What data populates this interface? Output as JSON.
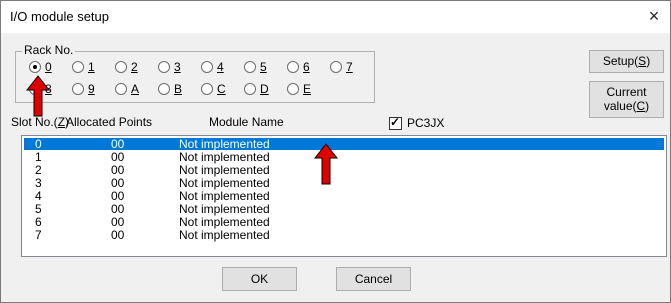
{
  "window": {
    "title": "I/O module setup",
    "close_glyph": "×"
  },
  "rack": {
    "legend": "Rack No.",
    "options": [
      "0",
      "1",
      "2",
      "3",
      "4",
      "5",
      "6",
      "7",
      "8",
      "9",
      "A",
      "B",
      "C",
      "D",
      "E"
    ],
    "selected": "0"
  },
  "buttons": {
    "setup_main": "Setup(",
    "setup_key": "S",
    "setup_end": ")",
    "current_line1": "Current",
    "current_line2_main": "value(",
    "current_key": "C",
    "current_end": ")",
    "ok": "OK",
    "cancel": "Cancel"
  },
  "pc3jx": {
    "label": "PC3JX",
    "checked": true
  },
  "table": {
    "col_slot_main": "Slot No.(",
    "col_slot_key": "Z",
    "col_slot_end": ")",
    "col_points": "Allocated Points",
    "col_module": "Module Name",
    "rows": [
      {
        "slot": "0",
        "points": "00",
        "module": "Not implemented"
      },
      {
        "slot": "1",
        "points": "00",
        "module": "Not implemented"
      },
      {
        "slot": "2",
        "points": "00",
        "module": "Not implemented"
      },
      {
        "slot": "3",
        "points": "00",
        "module": "Not implemented"
      },
      {
        "slot": "4",
        "points": "00",
        "module": "Not implemented"
      },
      {
        "slot": "5",
        "points": "00",
        "module": "Not implemented"
      },
      {
        "slot": "6",
        "points": "00",
        "module": "Not implemented"
      },
      {
        "slot": "7",
        "points": "00",
        "module": "Not implemented"
      }
    ],
    "selected_index": 0
  },
  "colors": {
    "selection": "#0078d7",
    "annotation_arrow": "#e00000"
  }
}
